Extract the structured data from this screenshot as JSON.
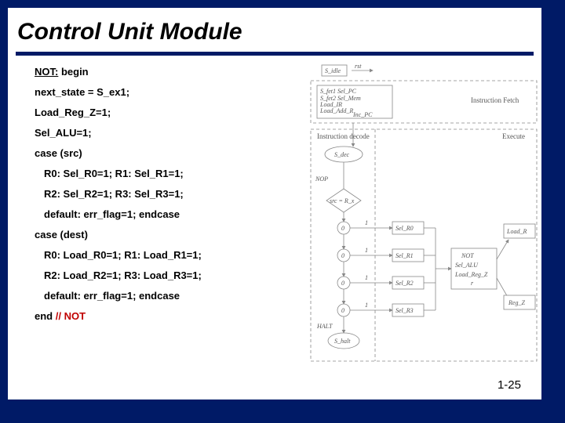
{
  "title": "Control Unit Module",
  "code": {
    "l1a": "NOT:",
    "l1b": " begin",
    "l2": "next_state = S_ex1;",
    "l3": "Load_Reg_Z=1;",
    "l4": "Sel_ALU=1;",
    "l5": "case  (src)",
    "l6": "R0: Sel_R0=1; R1: Sel_R1=1;",
    "l7": "R2: Sel_R2=1; R3: Sel_R3=1;",
    "l8": "default: err_flag=1; endcase",
    "l9": "case  (dest)",
    "l10": "R0: Load_R0=1; R1: Load_R1=1;",
    "l11": "R2: Load_R2=1; R3: Load_R3=1;",
    "l12": "default: err_flag=1; endcase",
    "l13a": "end    ",
    "l13b": "// NOT"
  },
  "diagram": {
    "top_label": "S_idle",
    "top_arrow": "rst",
    "fetch_lines": [
      "S_fet1  Sel_PC",
      "S_fet2  Sel_Mem",
      "         Load_IR",
      "Load_Add_R",
      "         Inc_PC"
    ],
    "fetch_caption": "Instruction Fetch",
    "decode_caption": "Instruction decode",
    "execute_caption": "Execute",
    "node_sdec": "S_dec",
    "left_labels": [
      "NOP",
      "src = R_x",
      "HALT"
    ],
    "node_halt": "S_halt",
    "leaf1": "Sel_R0",
    "leaf2": "Sel_R1",
    "leaf3": "Sel_R2",
    "leaf4": "Sel_R3",
    "mid_nodes": [
      "NOT",
      "Sel_ALU",
      "Load_Reg_Z",
      "r"
    ],
    "right_nodes": [
      "Load_R",
      "Reg_Z"
    ],
    "zeros": "0",
    "ones": "1"
  },
  "pagenum": "1-25"
}
